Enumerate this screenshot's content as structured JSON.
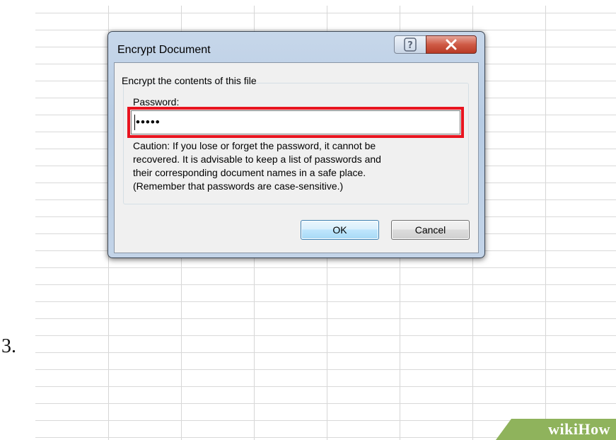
{
  "step_number": "3.",
  "watermark": {
    "prefix": "wiki",
    "suffix": "How"
  },
  "dialog": {
    "title": "Encrypt Document",
    "help_icon": "help-question-icon",
    "close_icon": "close-x-icon",
    "group_label": "Encrypt the contents of this file",
    "password_label": "Password:",
    "password_value": "•••••",
    "caution_lines": [
      "Caution: If you lose or forget the password, it cannot be",
      "recovered. It is advisable to keep a list of passwords and",
      "their corresponding document names in a safe place.",
      "(Remember that passwords are case-sensitive.)"
    ],
    "ok_label": "OK",
    "cancel_label": "Cancel"
  },
  "colors": {
    "highlight": "#e8141f",
    "title_bar": "#b6cbe3",
    "close_button": "#cf5a45",
    "watermark_green": "#8fb35c"
  }
}
